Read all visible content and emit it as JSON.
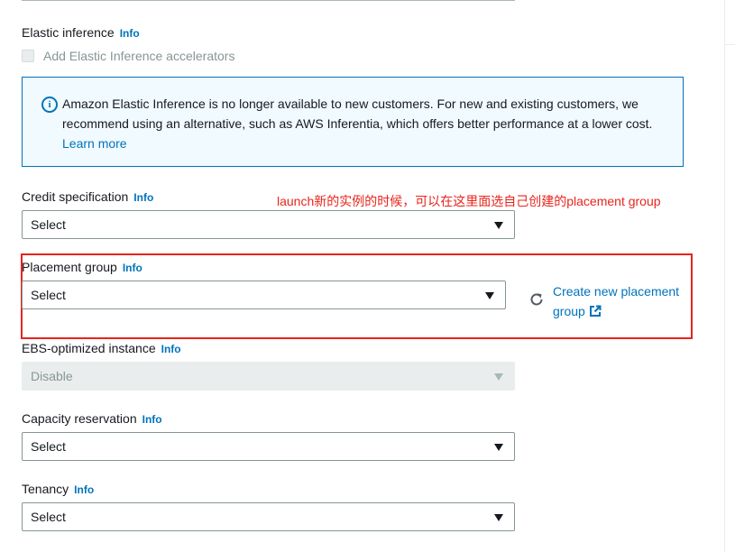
{
  "elastic_inference": {
    "label": "Elastic inference",
    "info": "Info",
    "checkbox_label": "Add Elastic Inference accelerators"
  },
  "alert": {
    "icon": "info-circle-icon",
    "message": "Amazon Elastic Inference is no longer available to new customers. For new and existing customers, we recommend using an alternative, such as AWS Inferentia, which offers better performance at a lower cost.",
    "link": "Learn more"
  },
  "credit_specification": {
    "label": "Credit specification",
    "info": "Info",
    "value": "Select"
  },
  "annotation": {
    "text": "launch新的实例的时候，可以在这里面选自己创建的placement group",
    "color": "#e8241c"
  },
  "placement_group": {
    "label": "Placement group",
    "info": "Info",
    "value": "Select",
    "refresh_icon": "refresh-icon",
    "create_link": "Create new placement group",
    "external_icon": "external-link-icon"
  },
  "ebs_optimized": {
    "label": "EBS-optimized instance",
    "info": "Info",
    "value": "Disable",
    "disabled": true
  },
  "capacity_reservation": {
    "label": "Capacity reservation",
    "info": "Info",
    "value": "Select"
  },
  "tenancy": {
    "label": "Tenancy",
    "info": "Info",
    "value": "Select"
  },
  "colors": {
    "link": "#0073bb",
    "alert_bg": "#f1faff",
    "annotation_red": "#e8241c"
  }
}
